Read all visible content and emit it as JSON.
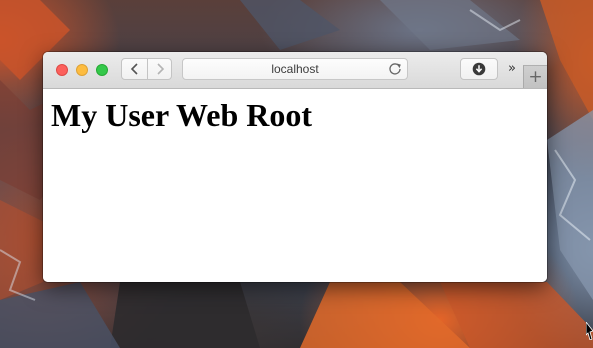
{
  "browser": {
    "url": "localhost",
    "back_icon": "chevron-left-icon",
    "forward_icon": "chevron-right-icon",
    "reload_icon": "reload-icon",
    "download_icon": "download-icon",
    "overflow_label": "»",
    "new_tab_label": "+"
  },
  "page": {
    "heading": "My User Web Root"
  },
  "colors": {
    "close": "#fc605c",
    "minimize": "#fdbc40",
    "maximize": "#34c84a"
  }
}
